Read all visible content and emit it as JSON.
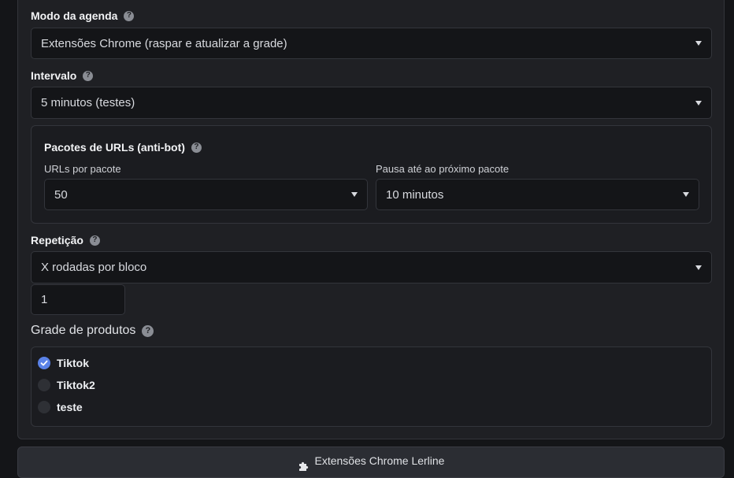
{
  "schedule_mode": {
    "label": "Modo da agenda",
    "value": "Extensões Chrome (raspar e atualizar a grade)"
  },
  "interval": {
    "label": "Intervalo",
    "value": "5 minutos (testes)"
  },
  "url_batches": {
    "title": "Pacotes de URLs (anti-bot)",
    "per_batch_label": "URLs por pacote",
    "per_batch_value": "50",
    "pause_label": "Pausa até ao próximo pacote",
    "pause_value": "10 minutos"
  },
  "repetition": {
    "label": "Repetição",
    "value": "X rodadas por bloco",
    "count": "1"
  },
  "product_grid": {
    "label": "Grade de produtos",
    "options": [
      {
        "label": "Tiktok",
        "checked": true
      },
      {
        "label": "Tiktok2",
        "checked": false
      },
      {
        "label": "teste",
        "checked": false
      }
    ]
  },
  "footer_button": {
    "label": "Extensões Chrome Lerline"
  },
  "icons": {
    "help": "question-circle-icon",
    "caret": "caret-down-icon",
    "check": "check-icon",
    "puzzle": "puzzle-piece-icon"
  },
  "colors": {
    "accent": "#5a82e8",
    "background": "#1f2024",
    "input_bg": "#141518"
  }
}
